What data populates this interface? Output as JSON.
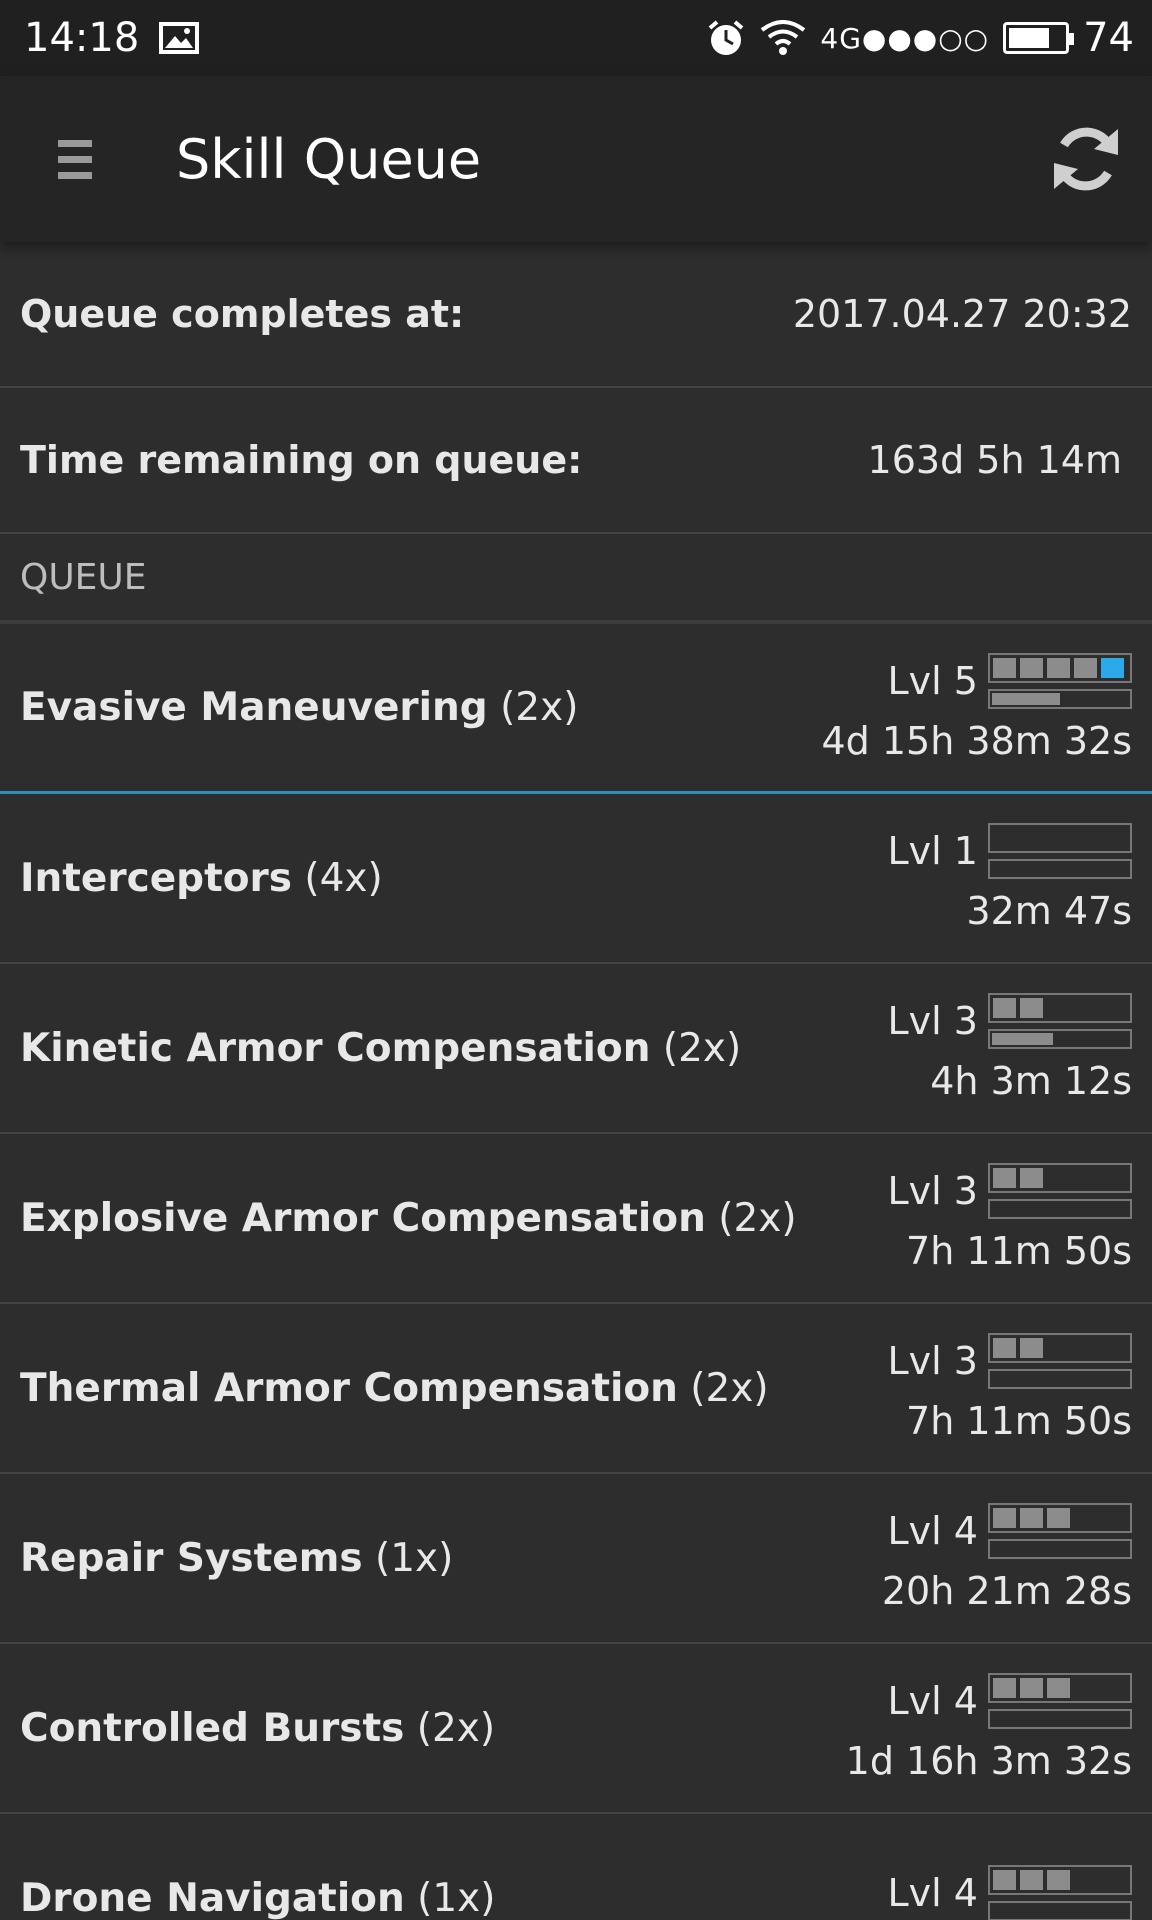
{
  "status_bar": {
    "time": "14:18",
    "network": "4G",
    "signal_dots": "●●●○○",
    "battery": "74",
    "battery_level": 0.74
  },
  "app_bar": {
    "title": "Skill Queue"
  },
  "summary": {
    "completes_label": "Queue completes at:",
    "completes_value": "2017.04.27 20:32",
    "remaining_label": "Time remaining on queue:",
    "remaining_value": "163d 5h 14m"
  },
  "queue_header": "QUEUE",
  "skills": [
    {
      "name": "Evasive Maneuvering",
      "mult": "(2x)",
      "level_label": "Lvl 5",
      "level": 5,
      "time": "4d 15h 38m 32s",
      "progress": 0.5,
      "active": true
    },
    {
      "name": "Interceptors",
      "mult": "(4x)",
      "level_label": "Lvl 1",
      "level": 1,
      "time": "32m 47s",
      "progress": 0,
      "active": false
    },
    {
      "name": "Kinetic Armor Compensation",
      "mult": "(2x)",
      "level_label": "Lvl 3",
      "level": 3,
      "time": "4h 3m 12s",
      "progress": 0.45,
      "active": false
    },
    {
      "name": "Explosive Armor Compensation",
      "mult": "(2x)",
      "level_label": "Lvl 3",
      "level": 3,
      "time": "7h 11m 50s",
      "progress": 0,
      "active": false
    },
    {
      "name": "Thermal Armor Compensation",
      "mult": "(2x)",
      "level_label": "Lvl 3",
      "level": 3,
      "time": "7h 11m 50s",
      "progress": 0,
      "active": false
    },
    {
      "name": "Repair Systems",
      "mult": "(1x)",
      "level_label": "Lvl 4",
      "level": 4,
      "time": "20h 21m 28s",
      "progress": 0,
      "active": false
    },
    {
      "name": "Controlled Bursts",
      "mult": "(2x)",
      "level_label": "Lvl 4",
      "level": 4,
      "time": "1d 16h 3m 32s",
      "progress": 0,
      "active": false
    },
    {
      "name": "Drone Navigation",
      "mult": "(1x)",
      "level_label": "Lvl 4",
      "level": 4,
      "time": "",
      "progress": 0,
      "active": false
    }
  ]
}
